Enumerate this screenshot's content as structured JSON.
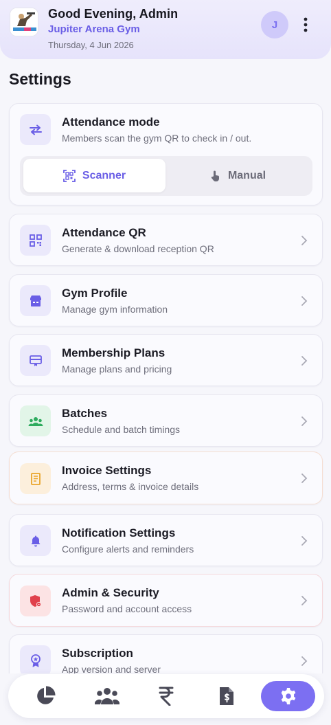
{
  "header": {
    "greeting": "Good Evening, Admin",
    "gym_name": "Jupiter Arena Gym",
    "date": "Thursday, 4 Jun 2026",
    "avatar_initial": "J"
  },
  "page": {
    "title": "Settings"
  },
  "attendance_mode": {
    "title": "Attendance mode",
    "subtitle": "Members scan the gym QR to check in / out.",
    "options": [
      "Scanner",
      "Manual"
    ],
    "selected": "Scanner"
  },
  "settings": [
    {
      "title": "Attendance QR",
      "subtitle": "Generate & download reception QR",
      "icon": "qr-code-icon"
    },
    {
      "title": "Gym Profile",
      "subtitle": "Manage gym information",
      "icon": "storefront-icon"
    },
    {
      "title": "Membership Plans",
      "subtitle": "Manage plans and pricing",
      "icon": "membership-card-icon"
    },
    {
      "title": "Batches",
      "subtitle": "Schedule and batch timings",
      "icon": "group-icon"
    },
    {
      "title": "Invoice Settings",
      "subtitle": "Address, terms & invoice details",
      "icon": "invoice-icon"
    },
    {
      "title": "Notification Settings",
      "subtitle": "Configure alerts and reminders",
      "icon": "bell-icon"
    },
    {
      "title": "Admin & Security",
      "subtitle": "Password and account access",
      "icon": "shield-icon"
    },
    {
      "title": "Subscription",
      "subtitle": "App version and server",
      "icon": "award-icon"
    }
  ],
  "bottom_nav": {
    "items": [
      "dashboard-pie-icon",
      "members-icon",
      "rupee-icon",
      "invoice-dollar-icon",
      "settings-gear-icon"
    ],
    "active": "settings-gear-icon"
  },
  "colors": {
    "accent": "#6a5ee6",
    "header_bg": "#e8e5fb",
    "page_bg": "#f6f6fb"
  }
}
